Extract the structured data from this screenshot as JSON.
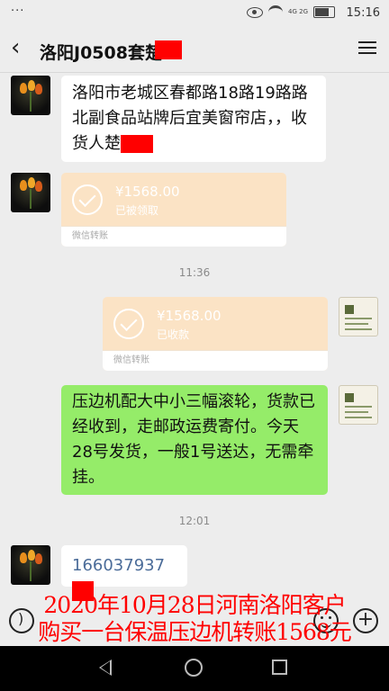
{
  "status_bar": {
    "dots": "···",
    "network_label": "4G 2G",
    "time": "15:16"
  },
  "header": {
    "title": "洛阳J0508套楚",
    "back_icon": "chevron-left-icon",
    "more_icon": "menu-icon"
  },
  "messages": {
    "m1": {
      "text": "洛阳市老城区春都路18路19路路北副食品站牌后宜美窗帘店，，收货人楚"
    },
    "m2": {
      "amount": "¥1568.00",
      "status": "已被领取",
      "footer": "微信转账"
    },
    "ts1": "11:36",
    "m3": {
      "amount": "¥1568.00",
      "status": "已收款",
      "footer": "微信转账"
    },
    "m4": {
      "text": "压边机配大中小三幅滚轮，货款已经收到，走邮政运费寄付。今天28号发货，一般1号送达，无需牵挂。"
    },
    "ts2": "12:01",
    "m5": {
      "text": "166037937"
    }
  },
  "caption": {
    "line1": "2020年10月28日河南洛阳客户",
    "line2": "购买一台保温压边机转账1568元"
  },
  "colors": {
    "redaction": "#ff0000",
    "caption": "#ff0000",
    "sent_bubble": "#95ec69",
    "transfer": "#fbe3c5"
  }
}
